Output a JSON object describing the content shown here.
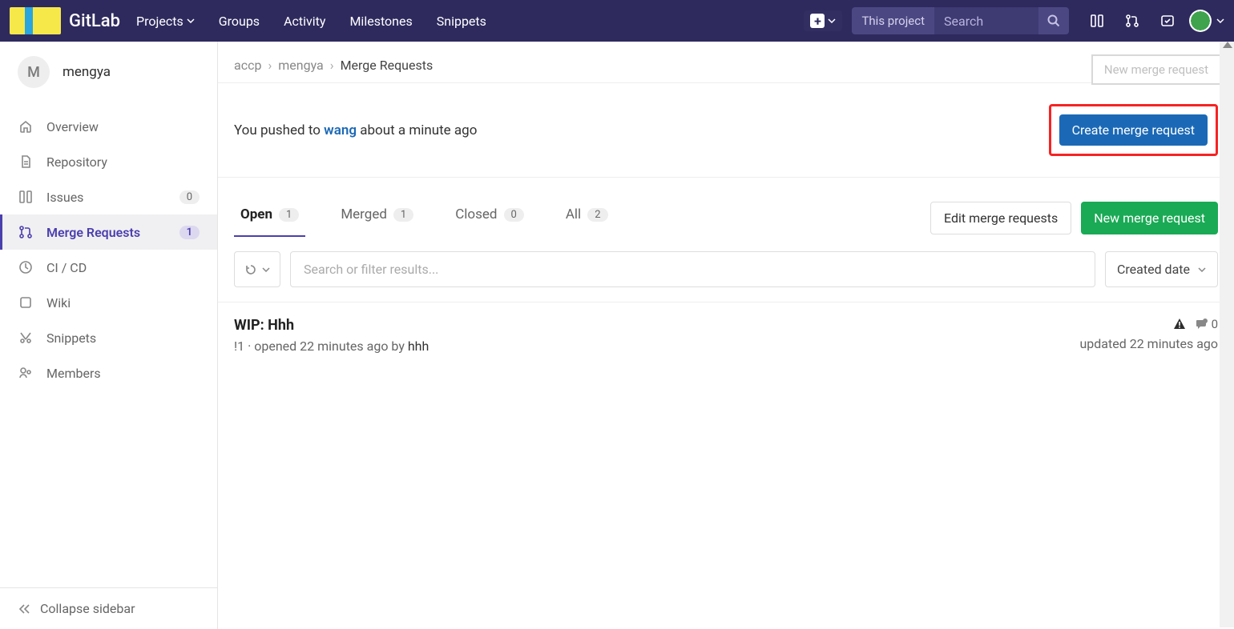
{
  "brand": "GitLab",
  "topnav": {
    "projects": "Projects",
    "groups": "Groups",
    "activity": "Activity",
    "milestones": "Milestones",
    "snippets": "Snippets"
  },
  "search": {
    "scope": "This project",
    "placeholder": "Search"
  },
  "sidebar": {
    "avatar_letter": "M",
    "name": "mengya",
    "items": {
      "overview": "Overview",
      "repository": "Repository",
      "issues": {
        "label": "Issues",
        "count": "0"
      },
      "merge_requests": {
        "label": "Merge Requests",
        "count": "1"
      },
      "cicd": "CI / CD",
      "wiki": "Wiki",
      "snippets": "Snippets",
      "members": "Members"
    },
    "collapse": "Collapse sidebar"
  },
  "breadcrumbs": {
    "b0": "accp",
    "b1": "mengya",
    "b2": "Merge Requests"
  },
  "ghost_button": "New merge request",
  "pushbar": {
    "prefix": "You pushed to ",
    "branch": "wang",
    "suffix": " about a minute ago",
    "create_button": "Create merge request"
  },
  "tabs": {
    "open": {
      "label": "Open",
      "count": "1"
    },
    "merged": {
      "label": "Merged",
      "count": "1"
    },
    "closed": {
      "label": "Closed",
      "count": "0"
    },
    "all": {
      "label": "All",
      "count": "2"
    }
  },
  "actions": {
    "edit": "Edit merge requests",
    "new": "New merge request"
  },
  "filter": {
    "placeholder": "Search or filter results...",
    "sort": "Created date"
  },
  "list": {
    "item0": {
      "title": "WIP: Hhh",
      "ref": "!1",
      "opened": "opened 22 minutes ago by",
      "author": "hhh",
      "comments": "0",
      "updated": "updated 22 minutes ago"
    }
  }
}
